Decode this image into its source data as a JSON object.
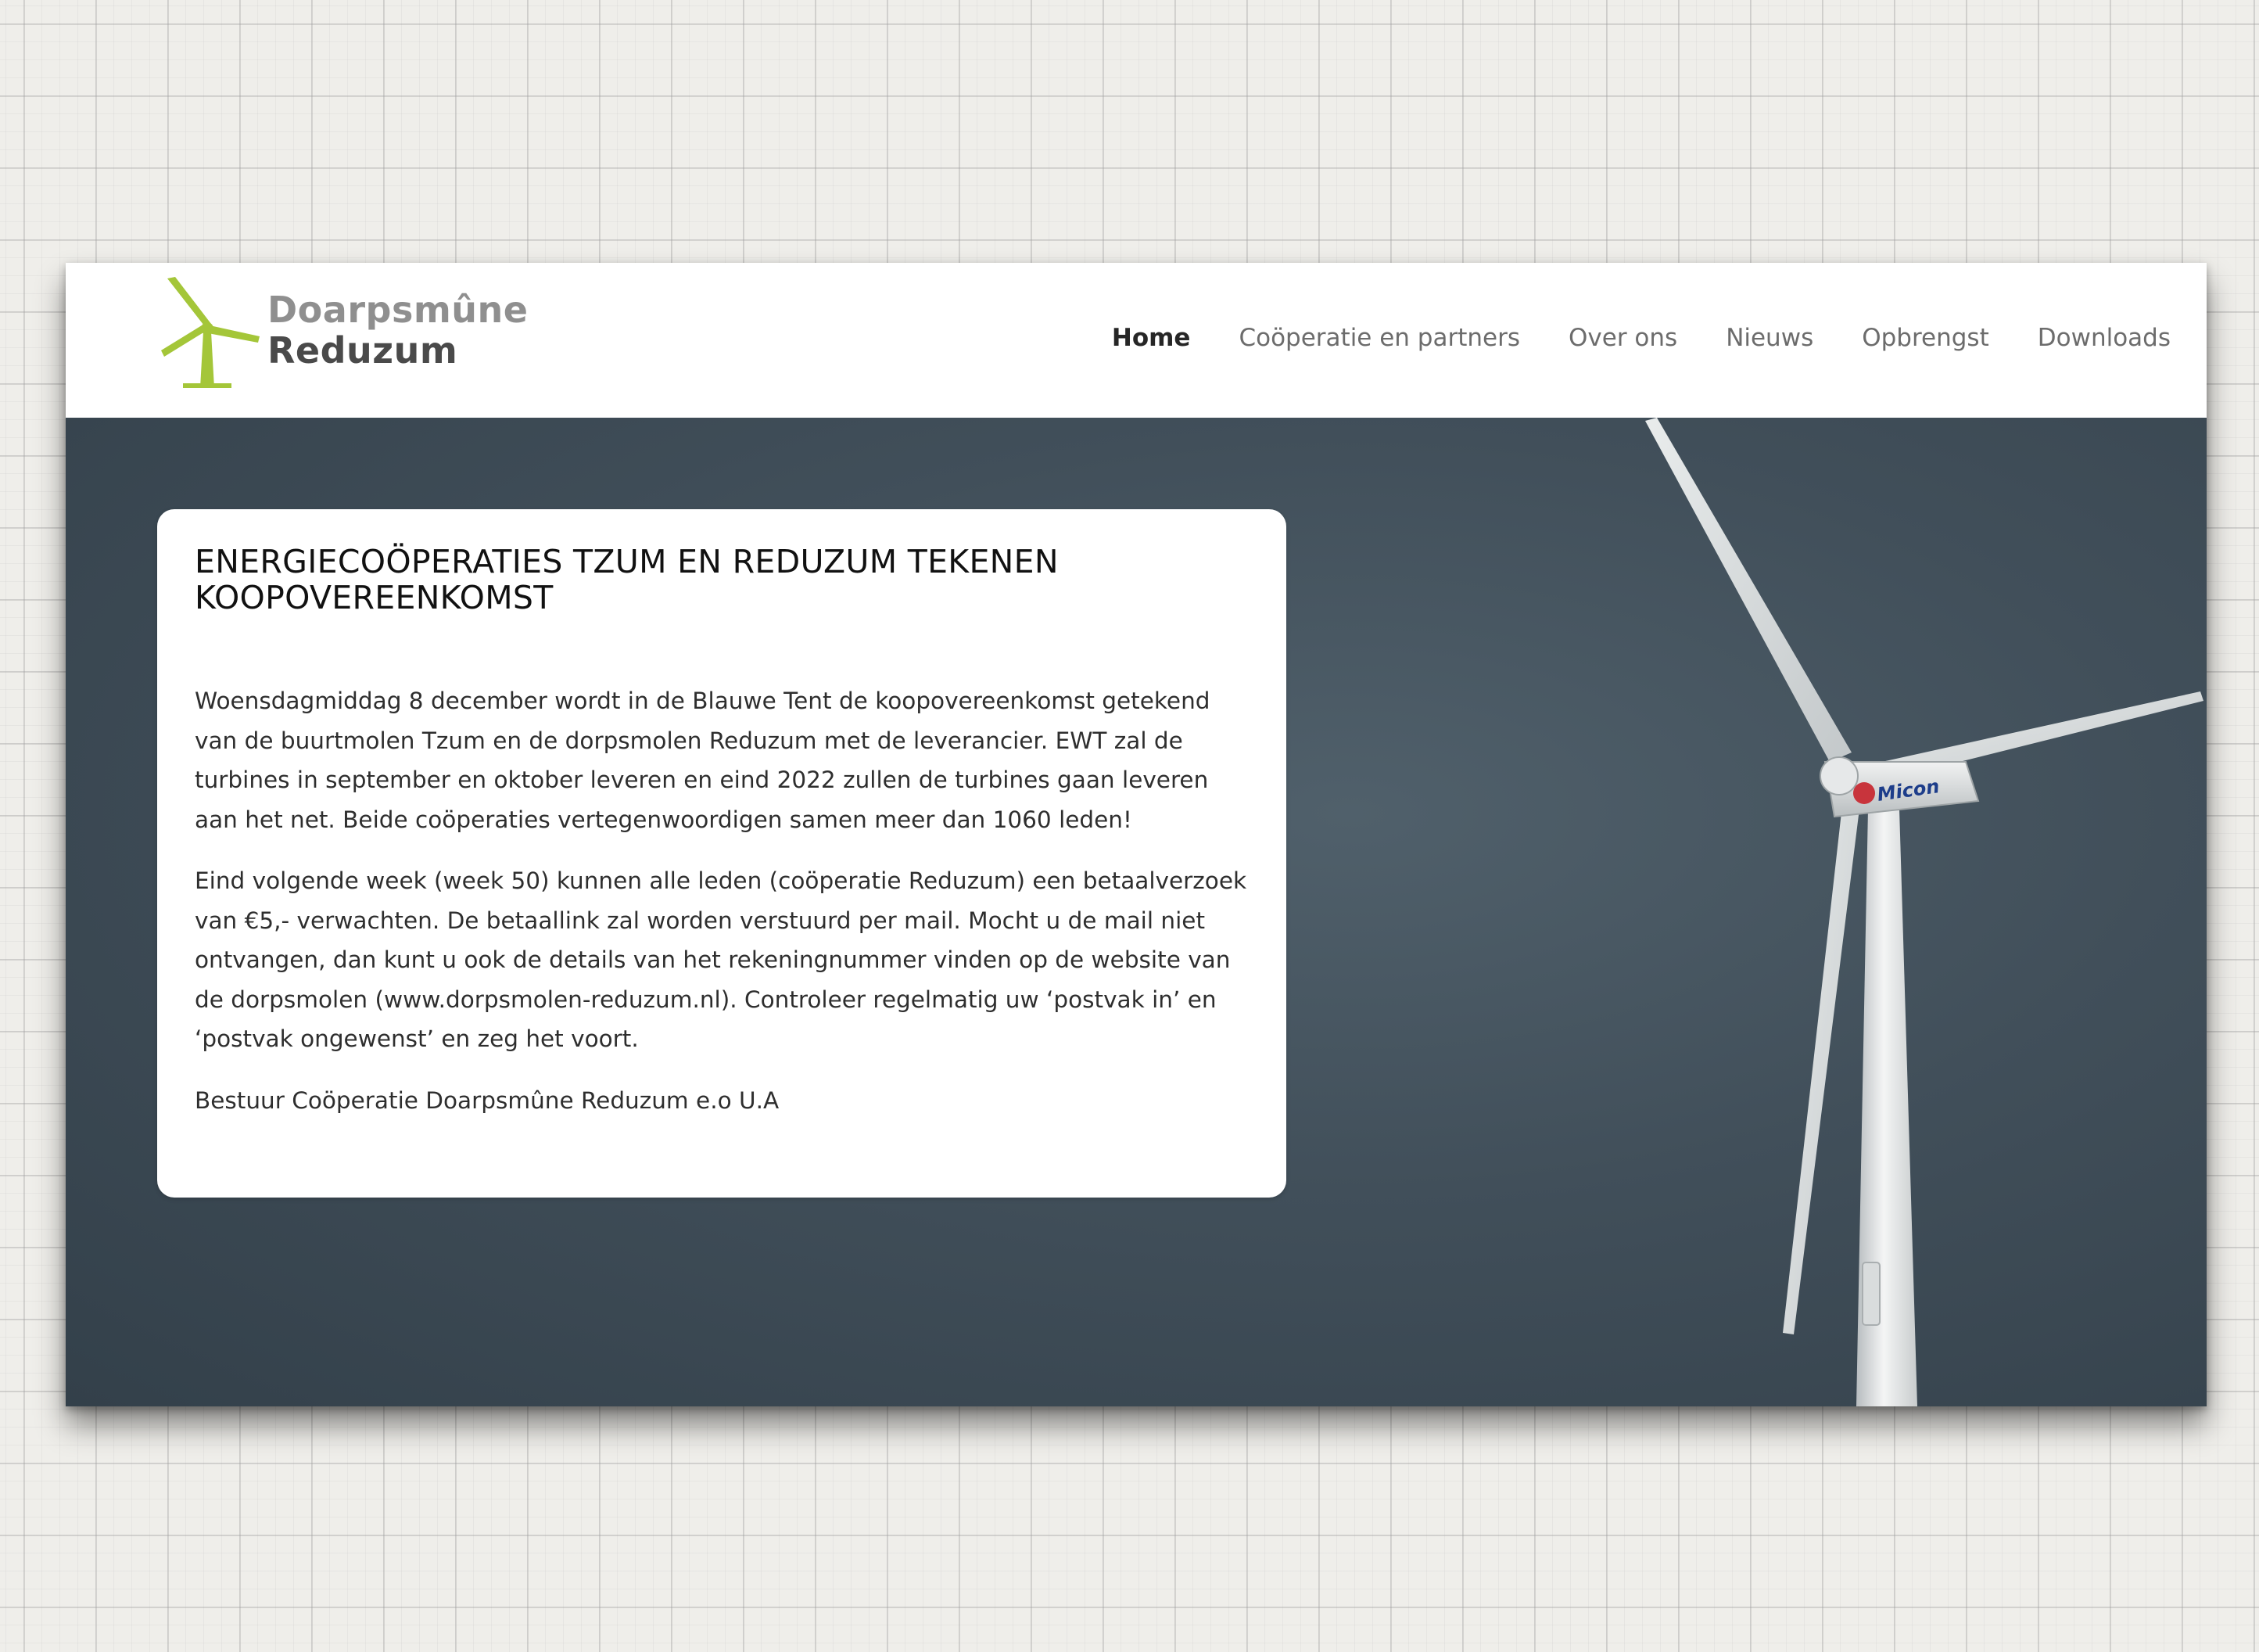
{
  "brand": {
    "line1": "Doarpsmûne",
    "line2": "Reduzum",
    "logo_icon": "wind-turbine-icon",
    "colors": {
      "accent_green": "#a4c639",
      "logo_gray": "#8f8f8f",
      "logo_dark": "#4a4a4a"
    }
  },
  "nav": {
    "items": [
      {
        "label": "Home",
        "active": true
      },
      {
        "label": "Coöperatie en partners",
        "active": false
      },
      {
        "label": "Over ons",
        "active": false
      },
      {
        "label": "Nieuws",
        "active": false
      },
      {
        "label": "Opbrengst",
        "active": false
      },
      {
        "label": "Downloads",
        "active": false
      }
    ]
  },
  "hero": {
    "background_image": "wind-turbine-photo",
    "turbine_label": "Micon",
    "sky_color": "#414f5a"
  },
  "article": {
    "title": "ENERGIECOÖPERATIES TZUM EN REDUZUM TEKENEN KOOPOVEREENKOMST",
    "paragraphs": [
      "Woensdagmiddag 8 december wordt in de Blauwe Tent de koopovereenkomst getekend van de buurtmolen Tzum en de dorpsmolen Reduzum met de leverancier. EWT zal de turbines in september en oktober leveren en eind 2022 zullen de turbines gaan leveren aan het net. Beide coöperaties vertegenwoordigen samen meer dan 1060 leden!",
      "Eind volgende week (week 50) kunnen alle leden (coöperatie Reduzum) een betaalverzoek van €5,- verwachten. De betaallink zal worden verstuurd per mail. Mocht u de mail niet ontvangen, dan kunt u ook de details van het rekeningnummer vinden op de website van de dorpsmolen (www.dorpsmolen-reduzum.nl). Controleer regelmatig uw ‘postvak in’ en ‘postvak ongewenst’ en zeg het voort.",
      "Bestuur Coöperatie Doarpsmûne Reduzum e.o U.A"
    ]
  }
}
